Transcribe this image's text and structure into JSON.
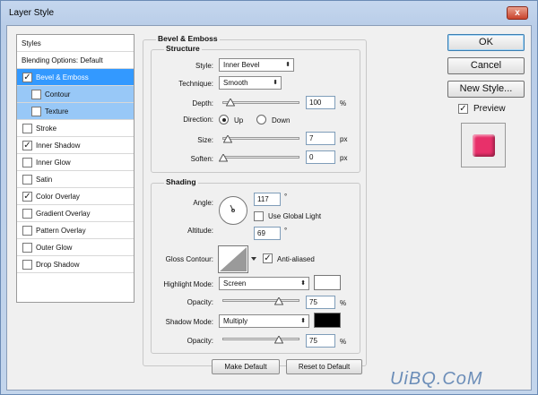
{
  "window": {
    "title": "Layer Style",
    "close_glyph": "x"
  },
  "styles_list": {
    "header": "Styles",
    "blending": "Blending Options: Default",
    "items": [
      {
        "label": "Bevel & Emboss",
        "checked": true,
        "selected": true,
        "sub": false
      },
      {
        "label": "Contour",
        "checked": false,
        "selected": false,
        "sub": true
      },
      {
        "label": "Texture",
        "checked": false,
        "selected": false,
        "sub": true
      },
      {
        "label": "Stroke",
        "checked": false,
        "selected": false,
        "sub": false
      },
      {
        "label": "Inner Shadow",
        "checked": true,
        "selected": false,
        "sub": false
      },
      {
        "label": "Inner Glow",
        "checked": false,
        "selected": false,
        "sub": false
      },
      {
        "label": "Satin",
        "checked": false,
        "selected": false,
        "sub": false
      },
      {
        "label": "Color Overlay",
        "checked": true,
        "selected": false,
        "sub": false
      },
      {
        "label": "Gradient Overlay",
        "checked": false,
        "selected": false,
        "sub": false
      },
      {
        "label": "Pattern Overlay",
        "checked": false,
        "selected": false,
        "sub": false
      },
      {
        "label": "Outer Glow",
        "checked": false,
        "selected": false,
        "sub": false
      },
      {
        "label": "Drop Shadow",
        "checked": false,
        "selected": false,
        "sub": false
      }
    ]
  },
  "bevel": {
    "section_title": "Bevel & Emboss",
    "structure_title": "Structure",
    "style_label": "Style:",
    "style_value": "Inner Bevel",
    "technique_label": "Technique:",
    "technique_value": "Smooth",
    "depth_label": "Depth:",
    "depth_value": "100",
    "depth_unit": "%",
    "direction_label": "Direction:",
    "direction_up": "Up",
    "direction_down": "Down",
    "size_label": "Size:",
    "size_value": "7",
    "size_unit": "px",
    "soften_label": "Soften:",
    "soften_value": "0",
    "soften_unit": "px"
  },
  "shading": {
    "title": "Shading",
    "angle_label": "Angle:",
    "angle_value": "117",
    "angle_unit": "°",
    "global_light_label": "Use Global Light",
    "altitude_label": "Altitude:",
    "altitude_value": "69",
    "altitude_unit": "°",
    "gloss_label": "Gloss Contour:",
    "anti_aliased_label": "Anti-aliased",
    "highlight_mode_label": "Highlight Mode:",
    "highlight_mode_value": "Screen",
    "highlight_color": "#ffffff",
    "hl_opacity_label": "Opacity:",
    "hl_opacity_value": "75",
    "hl_opacity_unit": "%",
    "shadow_mode_label": "Shadow Mode:",
    "shadow_mode_value": "Multiply",
    "shadow_color": "#000000",
    "sh_opacity_label": "Opacity:",
    "sh_opacity_value": "75",
    "sh_opacity_unit": "%"
  },
  "bottom_buttons": {
    "make_default": "Make Default",
    "reset_default": "Reset to Default"
  },
  "right_panel": {
    "ok": "OK",
    "cancel": "Cancel",
    "new_style": "New Style...",
    "preview_label": "Preview",
    "preview_color": "#e8306a"
  },
  "watermark": "UiBQ.CoM",
  "colors": {
    "selection": "#3399ff",
    "sub_selection": "#98c8f7",
    "titlebar": "#c3d5ec"
  }
}
